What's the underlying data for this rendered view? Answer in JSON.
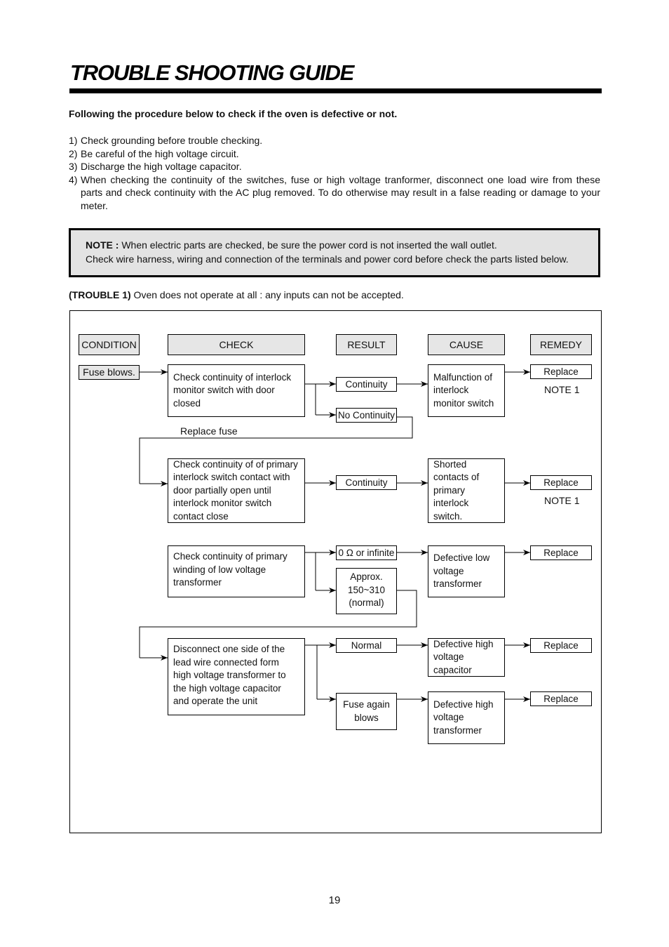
{
  "page": {
    "title": "TROUBLE SHOOTING GUIDE",
    "intro": "Following the procedure below to check if the oven is defective or not.",
    "steps": [
      {
        "num": "1)",
        "text": "Check grounding before trouble checking."
      },
      {
        "num": "2)",
        "text": "Be careful of the high voltage circuit."
      },
      {
        "num": "3)",
        "text": "Discharge the high voltage capacitor."
      },
      {
        "num": "4)",
        "text": "When checking the continuity of the switches, fuse or high voltage tranformer, disconnect one load wire from these parts and check continuity with the AC plug removed. To do otherwise may result in a false reading or damage to your meter."
      }
    ],
    "note": {
      "label": "NOTE :",
      "line1": " When electric parts are checked, be sure the power cord is not inserted the wall outlet.",
      "line2": "Check wire harness, wiring and connection of the terminals and power cord before check the parts listed below."
    },
    "trouble": {
      "label": "(TROUBLE 1)",
      "text": " Oven does not operate at all : any inputs can not be accepted."
    },
    "page_number": "19"
  },
  "flowchart": {
    "headers": {
      "condition": "CONDITION",
      "check": "CHECK",
      "result": "RESULT",
      "cause": "CAUSE",
      "remedy": "REMEDY"
    },
    "condition": "Fuse blows.",
    "steps": [
      {
        "check": "Check continuity of interlock monitor switch with door closed",
        "results": [
          "Continuity",
          "No Continuity"
        ],
        "cause": "Malfunction of interlock monitor switch",
        "remedy": "Replace",
        "remedy_note": "NOTE 1",
        "loop_label": "Replace fuse"
      },
      {
        "check": "Check continuity of of primary interlock switch contact with door partially open until interlock monitor switch contact close",
        "results": [
          "Continuity"
        ],
        "cause": "Shorted contacts of primary interlock switch.",
        "remedy": "Replace",
        "remedy_note": "NOTE 1"
      },
      {
        "check": "Check continuity of primary winding of low voltage transformer",
        "results": [
          "0 Ω or infinite",
          "Approx. 150~310 (normal)"
        ],
        "cause": "Defective low voltage transformer",
        "remedy": "Replace"
      },
      {
        "check": "Disconnect one side of the lead wire connected form high voltage transformer to the high voltage capacitor and operate the unit",
        "results": [
          "Normal",
          "Fuse again blows"
        ],
        "causes": [
          "Defective high voltage capacitor",
          "Defective high voltage transformer"
        ],
        "remedies": [
          "Replace",
          "Replace"
        ]
      }
    ]
  }
}
